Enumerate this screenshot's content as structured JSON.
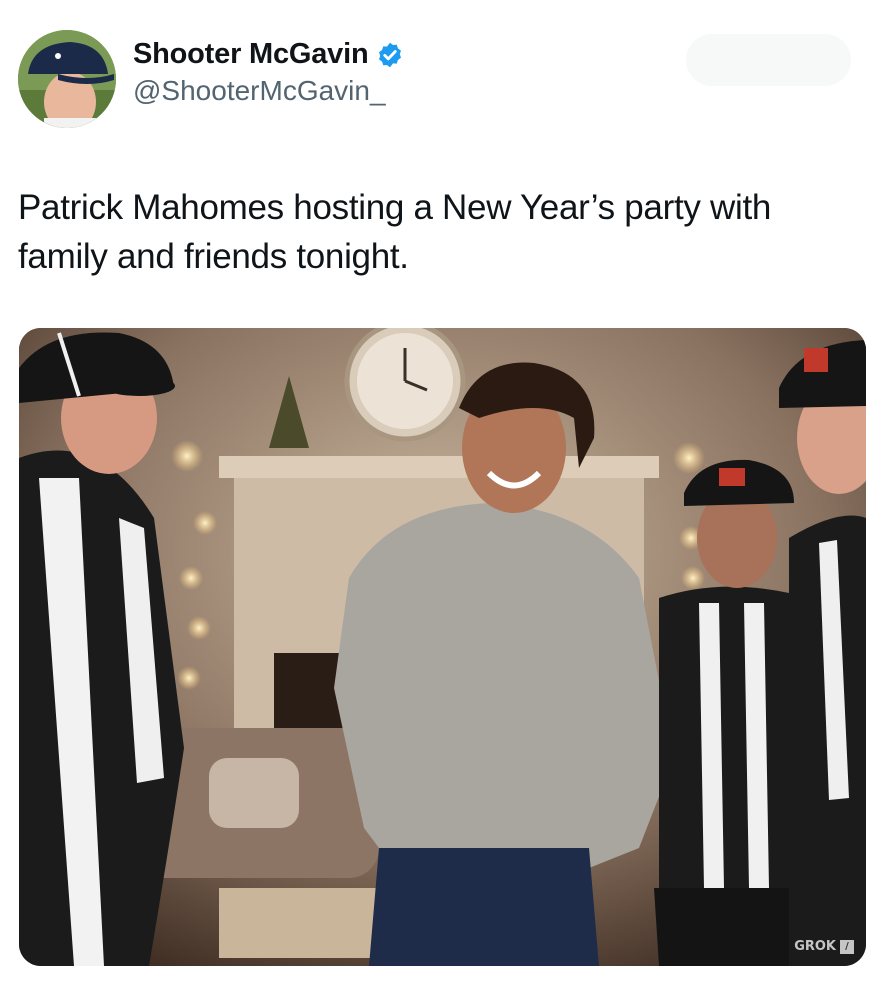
{
  "author": {
    "display_name": "Shooter McGavin",
    "handle": "@ShooterMcGavin_",
    "verified_icon": "verified-badge-icon",
    "verified_color": "#1d9bf0"
  },
  "tweet": {
    "text": "Patrick Mahomes hosting a New Year’s party with family and friends tonight."
  },
  "media": {
    "watermark": "GROK",
    "watermark_icon": "slash-box-icon"
  },
  "colors": {
    "text_primary": "#0f1419",
    "text_secondary": "#536471"
  }
}
